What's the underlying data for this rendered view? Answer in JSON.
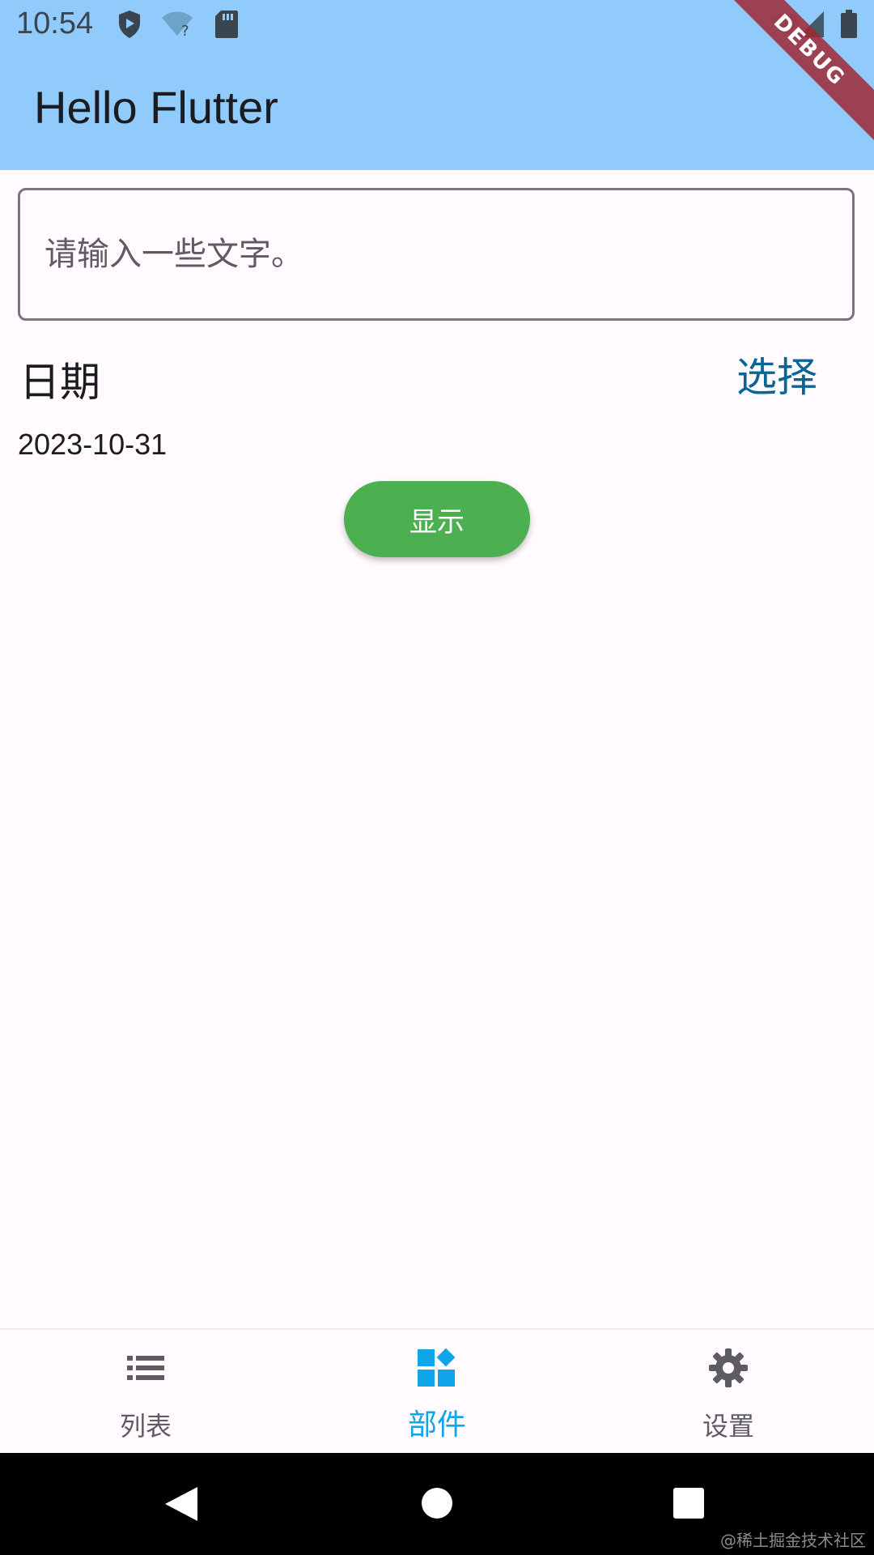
{
  "status_bar": {
    "time": "10:54",
    "icons": [
      "play-protect-icon",
      "wifi-question-icon",
      "sd-card-icon",
      "signal-icon",
      "battery-icon"
    ]
  },
  "app_bar": {
    "title": "Hello Flutter",
    "background": "#90cbfb",
    "debug_banner": "DEBUG"
  },
  "form": {
    "input_placeholder": "请输入一些文字。",
    "input_value": "",
    "date_label": "日期",
    "choose_label": "选择",
    "date_value": "2023-10-31",
    "show_label": "显示",
    "show_color": "#4caf50"
  },
  "bottom_nav": {
    "items": [
      {
        "label": "列表",
        "icon": "list-icon",
        "active": false
      },
      {
        "label": "部件",
        "icon": "widgets-icon",
        "active": true
      },
      {
        "label": "设置",
        "icon": "gear-icon",
        "active": false
      }
    ],
    "active_color": "#0ea5e9"
  },
  "system_nav": {
    "buttons": [
      "back-icon",
      "home-icon",
      "recents-icon"
    ]
  },
  "watermark": "@稀土掘金技术社区"
}
